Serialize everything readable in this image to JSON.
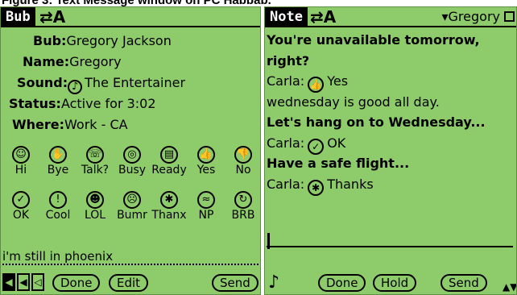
{
  "caption": "Figure 3: Text Message window on PC Habbab.",
  "icons": {
    "sync": "⇄A",
    "note": "♪",
    "nav_left": "◀",
    "nav_right": "◁",
    "scroll": "▲▼"
  },
  "left": {
    "tab": "Bub",
    "fields": {
      "bub_label": "Bub:",
      "bub_value": "Gregory Jackson",
      "name_label": "Name:",
      "name_value": "Gregory",
      "sound_label": "Sound:",
      "sound_value": "The Entertainer",
      "status_label": "Status:",
      "status_value": "Active for 3:02",
      "where_label": "Where:",
      "where_value": "Work - CA"
    },
    "emotes": [
      {
        "icon": "☺",
        "label": "Hi"
      },
      {
        "icon": "✋",
        "label": "Bye"
      },
      {
        "icon": "☏",
        "label": "Talk?"
      },
      {
        "icon": "◎",
        "label": "Busy"
      },
      {
        "icon": "▤",
        "label": "Ready"
      },
      {
        "icon": "👍",
        "label": "Yes"
      },
      {
        "icon": "👎",
        "label": "No"
      },
      {
        "icon": "✓",
        "label": "OK"
      },
      {
        "icon": "!",
        "label": "Cool"
      },
      {
        "icon": "☻",
        "label": "LOL"
      },
      {
        "icon": "☹",
        "label": "Bumr"
      },
      {
        "icon": "✱",
        "label": "Thanx"
      },
      {
        "icon": "≈",
        "label": "NP"
      },
      {
        "icon": "↻",
        "label": "BRB"
      }
    ],
    "message": "i'm still in phoenix",
    "buttons": {
      "done": "Done",
      "edit": "Edit",
      "send": "Send"
    }
  },
  "right": {
    "tab": "Note",
    "dropdown": "▾Gregory",
    "messages": [
      {
        "text": "You're unavailable tomorrow,",
        "bold": true
      },
      {
        "text": "right?",
        "bold": true
      },
      {
        "text": "Carla:",
        "icon": "👍",
        "tail": "Yes",
        "bold": false
      },
      {
        "text": "wednesday is good all day.",
        "bold": false
      },
      {
        "text": "Let's hang on to Wednesday...",
        "bold": true
      },
      {
        "text": "Carla:",
        "icon": "✓",
        "tail": "OK",
        "bold": false
      },
      {
        "text": "Have a safe flight...",
        "bold": true
      },
      {
        "text": "Carla:",
        "icon": "✱",
        "tail": "Thanks",
        "bold": false
      }
    ],
    "buttons": {
      "done": "Done",
      "hold": "Hold",
      "send": "Send"
    }
  }
}
